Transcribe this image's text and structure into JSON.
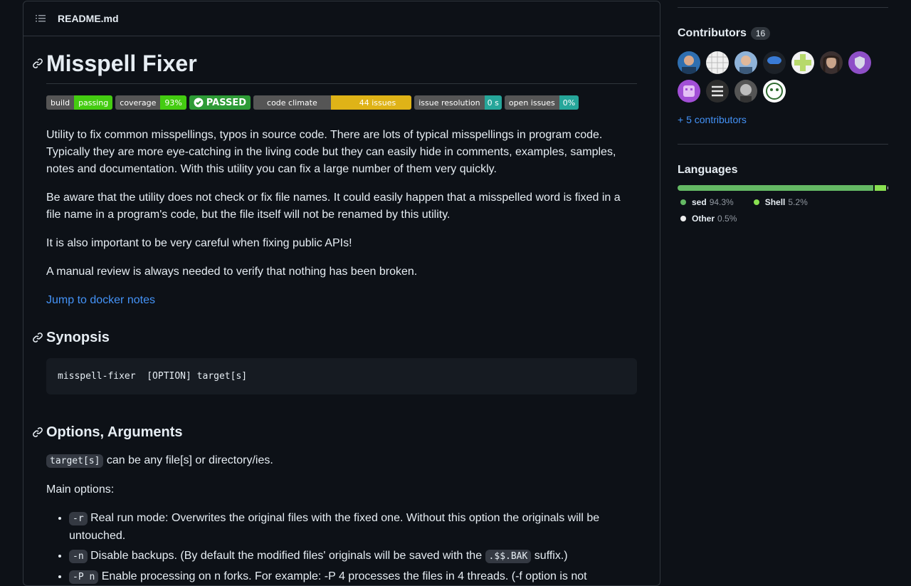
{
  "readme": {
    "filename": "README.md",
    "title": "Misspell Fixer",
    "badges": [
      {
        "label": "build",
        "value": "passing",
        "color": "#4c1"
      },
      {
        "label": "coverage",
        "value": "93%",
        "color": "#4c1"
      },
      {
        "label": "",
        "value": "PASSED",
        "color": "#2e9b36"
      },
      {
        "label": "code climate",
        "value": "44 issues",
        "color": "#dfb317"
      },
      {
        "label": "issue resolution",
        "value": "0 s",
        "color": "#26a69a"
      },
      {
        "label": "open issues",
        "value": "0%",
        "color": "#26a69a"
      }
    ],
    "paragraphs": [
      "Utility to fix common misspellings, typos in source code. There are lots of typical misspellings in program code. Typically they are more eye-catching in the living code but they can easily hide in comments, examples, samples, notes and documentation. With this utility you can fix a large number of them very quickly.",
      "Be aware that the utility does not check or fix file names. It could easily happen that a misspelled word is fixed in a file name in a program's code, but the file itself will not be renamed by this utility.",
      "It is also important to be very careful when fixing public APIs!",
      "A manual review is always needed to verify that nothing has been broken."
    ],
    "docker_link": "Jump to docker notes",
    "synopsis_heading": "Synopsis",
    "synopsis_code": "misspell-fixer  [OPTION] target[s]",
    "options_heading": "Options, Arguments",
    "target_code": "target[s]",
    "target_text": " can be any file[s] or directory/ies.",
    "main_options": "Main options:",
    "options": [
      {
        "flag": "-r",
        "text": " Real run mode: Overwrites the original files with the fixed one. Without this option the originals will be untouched."
      },
      {
        "flag": "-n",
        "text_before": " Disable backups. (By default the modified files' originals will be saved with the ",
        "code": ".$$.BAK",
        "text_after": " suffix.)"
      },
      {
        "flag": "-P n",
        "text": " Enable processing on n forks. For example: -P 4 processes the files in 4 threads. (-f option is not"
      }
    ]
  },
  "sidebar": {
    "contributors_heading": "Contributors",
    "contributors_count": "16",
    "avatars": [
      "avatar-1",
      "avatar-2",
      "avatar-3",
      "avatar-4",
      "avatar-5",
      "avatar-6",
      "avatar-7",
      "avatar-8",
      "avatar-9",
      "avatar-10",
      "avatar-11"
    ],
    "more_contributors": "+ 5 contributors",
    "languages_heading": "Languages",
    "languages": [
      {
        "name": "sed",
        "pct": "94.3%",
        "value": 94.3,
        "color": "#64b964"
      },
      {
        "name": "Shell",
        "pct": "5.2%",
        "value": 5.2,
        "color": "#89e051"
      },
      {
        "name": "Other",
        "pct": "0.5%",
        "value": 0.5,
        "color": "#ededed"
      }
    ]
  }
}
